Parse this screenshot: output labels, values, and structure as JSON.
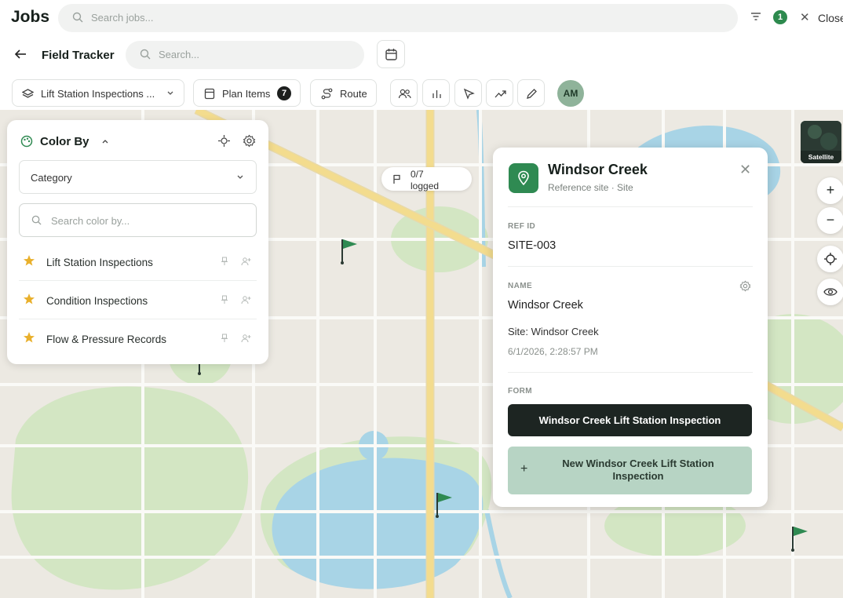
{
  "topbar": {
    "title": "Jobs",
    "search_placeholder": "Search jobs...",
    "filter_count": "1",
    "close_label": "Close"
  },
  "subbar": {
    "title": "Field Tracker",
    "search_placeholder": "Search..."
  },
  "toolbar": {
    "layer_label": "Lift Station Inspections ...",
    "plan_items_label": "Plan Items",
    "plan_items_count": "7",
    "route_label": "Route",
    "avatar_initials": "AM"
  },
  "color_by": {
    "title": "Color By",
    "selected": "Category",
    "search_placeholder": "Search color by...",
    "items": [
      {
        "label": "Lift Station Inspections"
      },
      {
        "label": "Condition Inspections"
      },
      {
        "label": "Flow & Pressure Records"
      }
    ]
  },
  "map": {
    "logged_count": "0/7",
    "logged_label": "logged",
    "satellite_label": "Satellite",
    "zoom_in": "+",
    "zoom_out": "−"
  },
  "detail": {
    "title": "Windsor Creek",
    "subtitle": "Reference site · Site",
    "ref_id_caption": "REF ID",
    "ref_id": "SITE-003",
    "name_caption": "NAME",
    "name": "Windsor Creek",
    "site_line": "Site: Windsor Creek",
    "timestamp": "6/1/2026, 2:28:57 PM",
    "form_caption": "FORM",
    "form_button": "Windsor Creek Lift Station Inspection",
    "new_form_button": "New Windsor Creek Lift Station Inspection"
  },
  "colors": {
    "accent_green": "#2f8a52",
    "dark_button": "#1d2522",
    "map_water": "#a8d4e6",
    "map_park": "#d3e6c3",
    "map_road_major": "#f3dc8e"
  }
}
